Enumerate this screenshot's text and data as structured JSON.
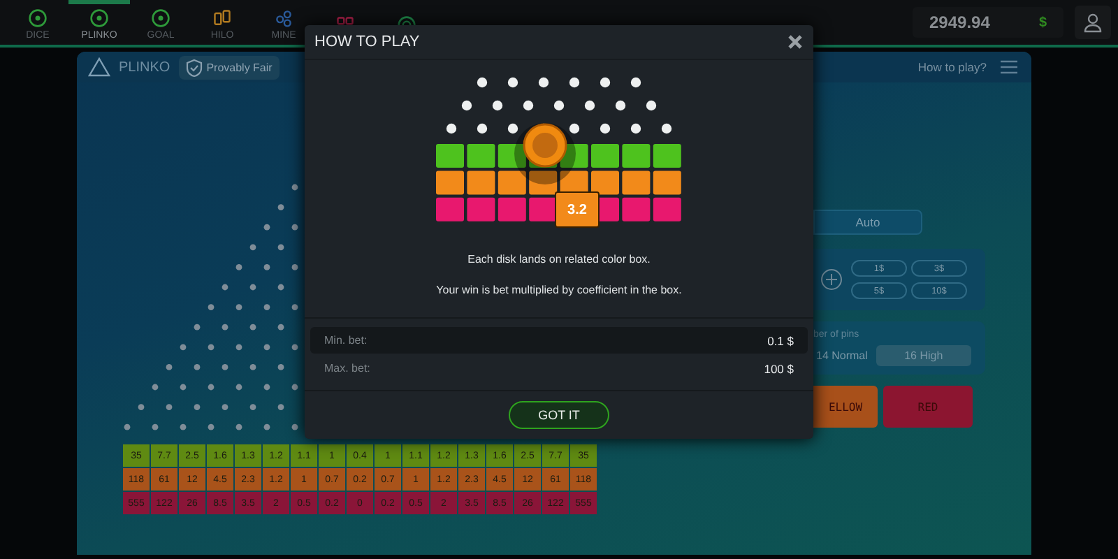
{
  "nav": {
    "tabs": [
      {
        "label": "DICE",
        "selected": false
      },
      {
        "label": "PLINKO",
        "selected": true
      },
      {
        "label": "GOAL",
        "selected": false
      },
      {
        "label": "HILO",
        "selected": false
      },
      {
        "label": "MINE",
        "selected": false
      }
    ]
  },
  "balance": {
    "amount": "2949.94",
    "currency": "$"
  },
  "game": {
    "title": "PLINKO",
    "badge": "Provably Fair",
    "help_link": "How to play?"
  },
  "multipliers": [
    {
      "color": "#5f8a12",
      "values": [
        "35",
        "7.7",
        "2.5",
        "1.6",
        "1.3",
        "1.2",
        "1.1",
        "1",
        "0.4",
        "1",
        "1.1",
        "1.2",
        "1.3",
        "1.6",
        "2.5",
        "7.7",
        "35"
      ]
    },
    {
      "color": "#a9531a",
      "values": [
        "118",
        "61",
        "12",
        "4.5",
        "2.3",
        "1.2",
        "1",
        "0.7",
        "0.2",
        "0.7",
        "1",
        "1.2",
        "2.3",
        "4.5",
        "12",
        "61",
        "118"
      ]
    },
    {
      "color": "#8a1538",
      "values": [
        "555",
        "122",
        "26",
        "8.5",
        "3.5",
        "2",
        "0.5",
        "0.2",
        "0",
        "0.2",
        "0.5",
        "2",
        "3.5",
        "8.5",
        "26",
        "122",
        "555"
      ]
    }
  ],
  "controls": {
    "mode_tab": "Auto",
    "chips": [
      "1$",
      "3$",
      "5$",
      "10$"
    ],
    "pins_label": "ber of pins",
    "pins_options": [
      {
        "label": "14 Normal",
        "selected": false
      },
      {
        "label": "16 High",
        "selected": true
      }
    ],
    "color_buttons": [
      {
        "label": "ELLOW",
        "color": "#a8501a"
      },
      {
        "label": "RED",
        "color": "#8c1530"
      }
    ]
  },
  "modal": {
    "title": "HOW TO PLAY",
    "sample_coefficient": "3.2",
    "lines": [
      "Each disk lands on related color box.",
      "Your win is bet multiplied by coefficient in the box."
    ],
    "limits": [
      {
        "label": "Min. bet:",
        "value": "0.1 $"
      },
      {
        "label": "Max. bet:",
        "value": "100 $"
      }
    ],
    "button": "GOT IT"
  }
}
